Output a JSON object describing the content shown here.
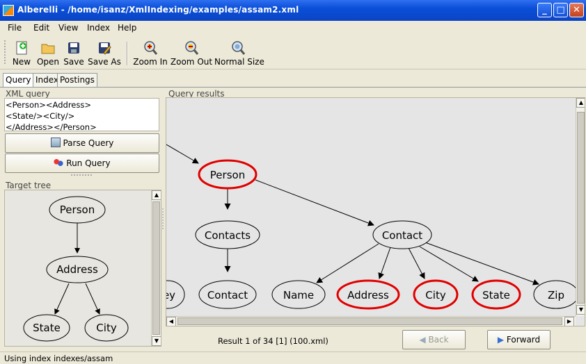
{
  "window": {
    "title": "Alberelli - /home/isanz/XmlIndexing/examples/assam2.xml",
    "minimize": "_",
    "maximize": "□",
    "close": "✕"
  },
  "menu": [
    "File",
    "Edit",
    "View",
    "Index",
    "Help"
  ],
  "toolbar": {
    "new": "New",
    "open": "Open",
    "save": "Save",
    "save_as": "Save As",
    "zoom_in": "Zoom In",
    "zoom_out": "Zoom Out",
    "normal_size": "Normal Size"
  },
  "tabs": [
    "Query",
    "Index",
    "Postings"
  ],
  "query_panel": {
    "label": "XML query",
    "lines": [
      "<Person><Address>",
      "<State/><City/>",
      "</Address></Person>"
    ],
    "parse_button": "Parse Query",
    "run_button": "Run Query"
  },
  "target_tree": {
    "label": "Target tree",
    "nodes": [
      "Person",
      "Address",
      "State",
      "City"
    ]
  },
  "results": {
    "label": "Query results",
    "nodes": [
      "Person",
      "Contacts",
      "Contact",
      "Contact",
      "ey",
      "Name",
      "Address",
      "City",
      "State",
      "Zip"
    ],
    "highlighted": [
      "Person",
      "Address",
      "City",
      "State"
    ],
    "status": "Result 1 of 34 [1] (100.xml)",
    "back": "Back",
    "forward": "Forward"
  },
  "status_bar": "Using index indexes/assam",
  "colors": {
    "highlight": "#e00000",
    "titlebar": "#0a4fd8"
  }
}
